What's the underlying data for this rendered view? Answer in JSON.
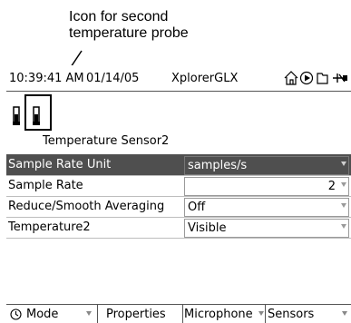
{
  "callout": {
    "line1": "Icon for second",
    "line2": "temperature probe"
  },
  "status_bar": {
    "time": "10:39:41 AM",
    "date": "01/14/05",
    "app_name": "XplorerGLX",
    "icons": [
      "home-icon",
      "play-icon",
      "folder-icon",
      "power-plug-icon"
    ]
  },
  "sensor": {
    "icons": [
      "thermometer-icon",
      "thermometer-icon"
    ],
    "name": "Temperature Sensor2"
  },
  "properties": [
    {
      "label": "Sample Rate Unit",
      "value": "samples/s",
      "selected": true
    },
    {
      "label": "Sample Rate",
      "value": "2",
      "align": "right"
    },
    {
      "label": "Reduce/Smooth Averaging",
      "value": "Off"
    },
    {
      "label": "Temperature2",
      "value": "Visible"
    }
  ],
  "softkeys": {
    "mode_icon": "clock-icon",
    "mode": "Mode",
    "properties": "Properties",
    "microphone": "Microphone",
    "sensors": "Sensors"
  },
  "colors": {
    "selected_row": "#4f4f4f",
    "background": "#ffffff"
  }
}
